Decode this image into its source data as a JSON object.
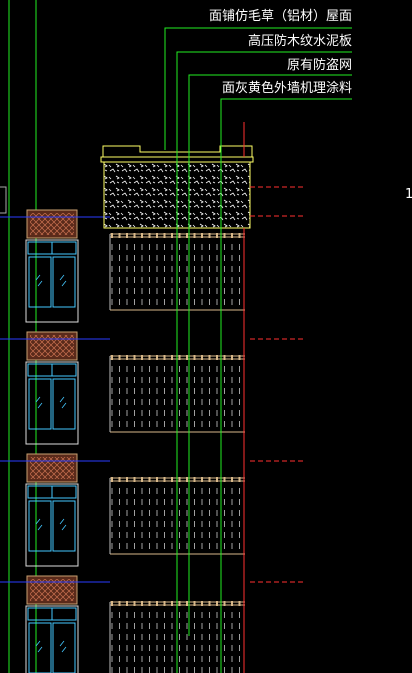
{
  "annotations": [
    {
      "id": "roof-finish",
      "text": "面铺仿毛草（铝材）屋面"
    },
    {
      "id": "cement-board",
      "text": "高压防木纹水泥板"
    },
    {
      "id": "anti-theft-net",
      "text": "原有防盗网"
    },
    {
      "id": "wall-coating",
      "text": "面灰黄色外墙机理涂料"
    }
  ],
  "edge_mark": "1",
  "colors": {
    "background": "#000000",
    "text": "#ffffff",
    "leader": "#22ee22",
    "axis_red": "#ff3030",
    "axis_blue": "#2a3cff",
    "hatch": "#ffffff",
    "outline_yellow": "#ffff66",
    "railing_tan": "#d9b98a",
    "window_cyan": "#44c8ff",
    "awning_brown": "#a05a3c"
  }
}
